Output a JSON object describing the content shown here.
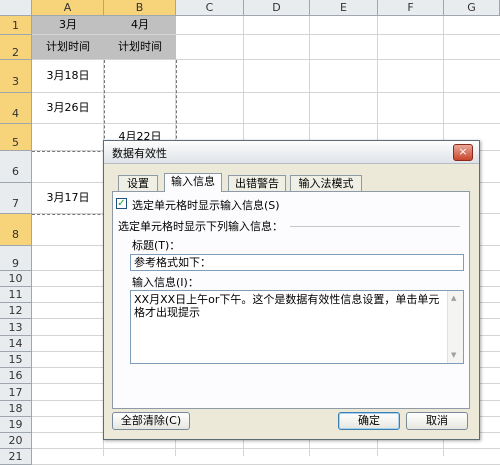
{
  "columns": [
    "A",
    "B",
    "C",
    "D",
    "E",
    "F",
    "G"
  ],
  "rows": [
    "1",
    "2",
    "3",
    "4",
    "5",
    "6",
    "7",
    "8",
    "9",
    "10",
    "11",
    "12",
    "13",
    "14",
    "15",
    "16",
    "17",
    "18",
    "19",
    "20",
    "21"
  ],
  "cells": {
    "a1": "3月",
    "b1": "4月",
    "a2": "计划时间",
    "b2": "计划时间",
    "a3": "3月18日",
    "a4": "3月26日",
    "b5": "4月22日",
    "a7": "3月17日"
  },
  "dialog": {
    "title": "数据有效性",
    "close": "×",
    "tabs": [
      "设置",
      "输入信息",
      "出错警告",
      "输入法模式"
    ],
    "show_checkbox_label": "选定单元格时显示输入信息(S)",
    "show_checked": true,
    "section_label": "选定单元格时显示下列输入信息：",
    "title_label": "标题(T)：",
    "title_value": "参考格式如下：",
    "message_label": "输入信息(I)：",
    "message_value": "XX月XX日上午or下午。这个是数据有效性信息设置，单击单元格才出现提示",
    "clear_all": "全部清除(C)",
    "ok": "确定",
    "cancel": "取消"
  },
  "colors": {
    "header_selected": "#f7d47a",
    "header_fill": "#c0c0c0",
    "dialog_bg": "#ece9d8"
  }
}
